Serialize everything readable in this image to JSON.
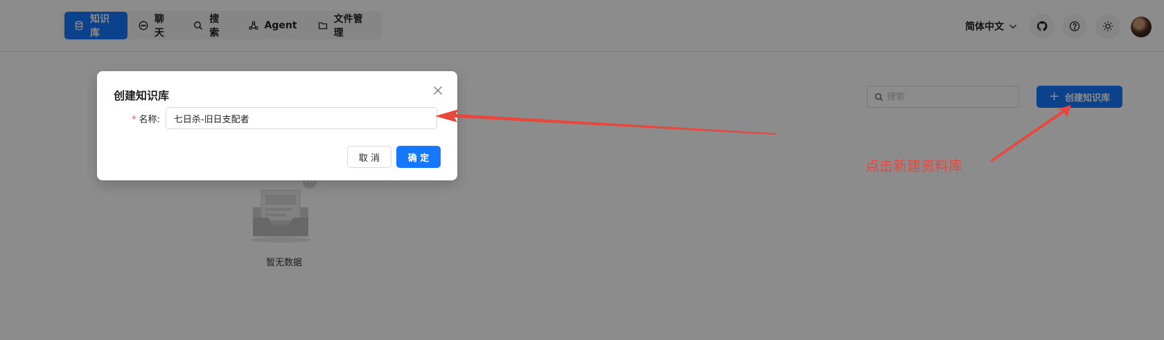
{
  "nav": {
    "items": [
      {
        "label": "知识库",
        "icon": "database-icon",
        "active": true
      },
      {
        "label": "聊天",
        "icon": "chat-icon",
        "active": false
      },
      {
        "label": "搜索",
        "icon": "search-icon",
        "active": false
      },
      {
        "label": "Agent",
        "icon": "agent-icon",
        "active": false
      },
      {
        "label": "文件管理",
        "icon": "folder-icon",
        "active": false
      }
    ]
  },
  "header": {
    "language": "简体中文",
    "icons": [
      "github-icon",
      "help-icon",
      "theme-sun-icon"
    ]
  },
  "toolbar": {
    "search_placeholder": "搜索",
    "create_label": "创建知识库"
  },
  "empty_state": {
    "text": "暂无数据"
  },
  "modal": {
    "title": "创建知识库",
    "name_label": "名称:",
    "name_value": "七日杀-旧日支配者",
    "cancel_label": "取 消",
    "ok_label": "确 定"
  },
  "annotation": {
    "text": "点击新建资料库",
    "color": "#e8473d"
  },
  "colors": {
    "primary": "#1677ff",
    "mask": "rgba(0,0,0,0.45)"
  }
}
